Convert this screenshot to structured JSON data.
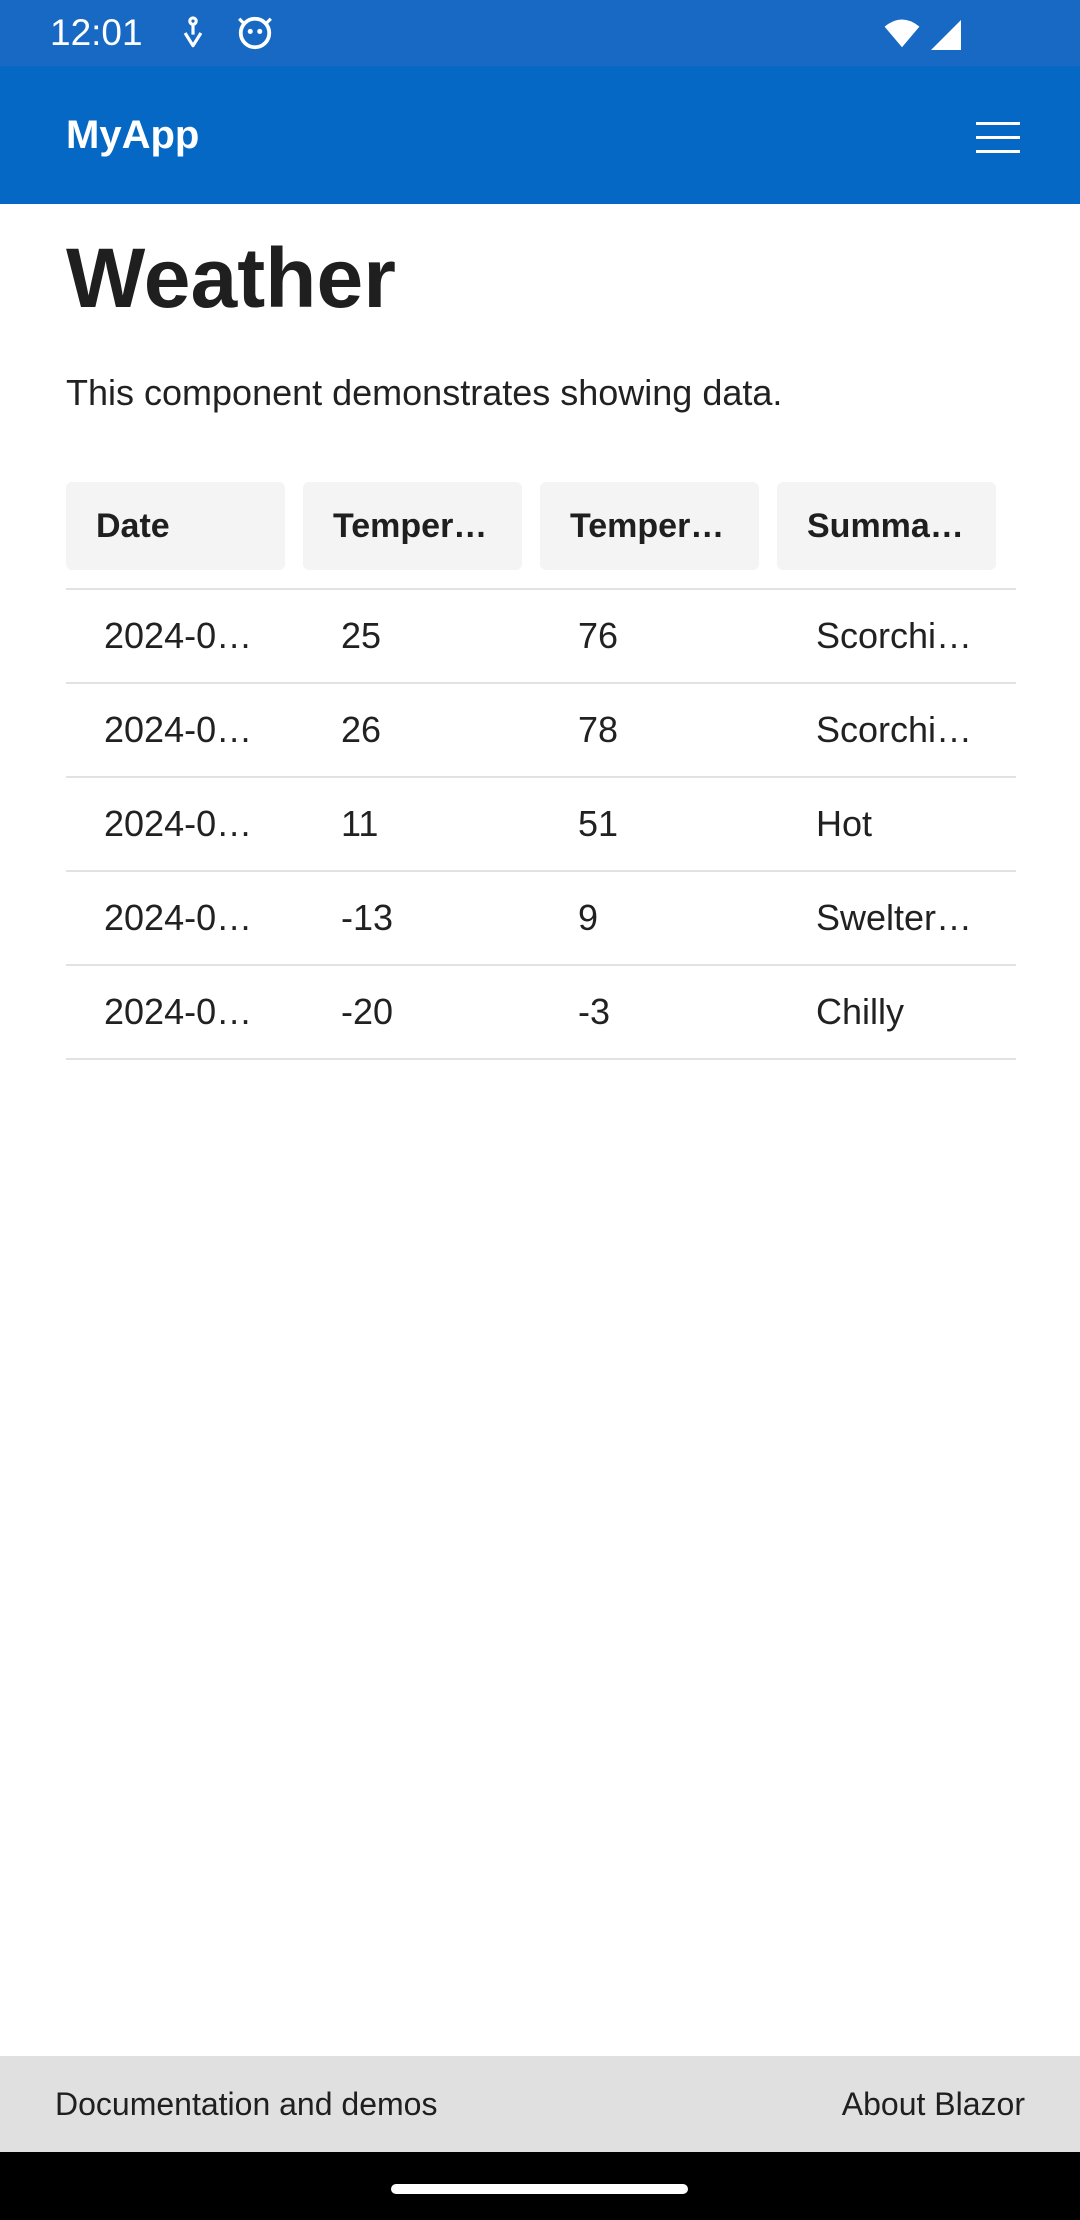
{
  "status_bar": {
    "time": "12:01"
  },
  "app_bar": {
    "title": "MyApp",
    "menu_icon": "hamburger-menu-icon"
  },
  "page": {
    "title": "Weather",
    "description": "This component demonstrates showing data."
  },
  "table": {
    "columns": [
      "Date",
      "Temper…",
      "Temper…",
      "Summa…"
    ],
    "rows": [
      [
        "2024-0…",
        "25",
        "76",
        "Scorchi…"
      ],
      [
        "2024-0…",
        "26",
        "78",
        "Scorchi…"
      ],
      [
        "2024-0…",
        "11",
        "51",
        "Hot"
      ],
      [
        "2024-0…",
        "-13",
        "9",
        "Swelter…"
      ],
      [
        "2024-0…",
        "-20",
        "-3",
        "Chilly"
      ]
    ]
  },
  "footer": {
    "left_link": "Documentation and demos",
    "right_link": "About Blazor"
  },
  "colors": {
    "status_bar": "#1769c4",
    "app_bar": "#0668c5",
    "footer": "#e0e0e0"
  }
}
